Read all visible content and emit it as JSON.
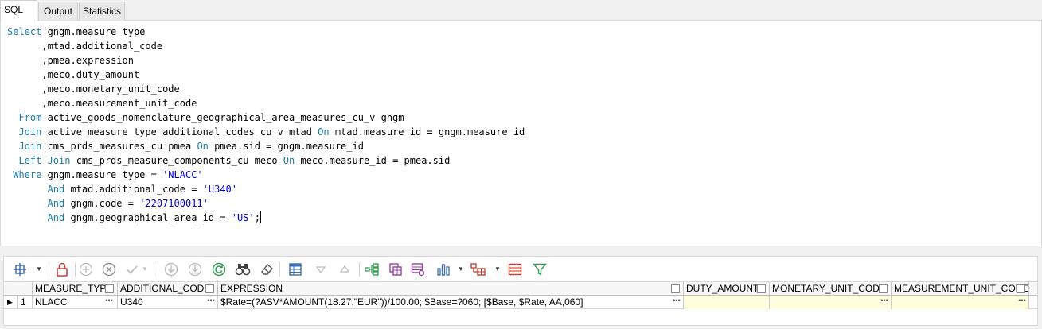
{
  "tabs": {
    "sql": "SQL",
    "output": "Output",
    "statistics": "Statistics"
  },
  "editor": {
    "lines": [
      [
        {
          "t": "Select",
          "k": "kw"
        },
        {
          "t": " gngm.measure_type"
        }
      ],
      [
        {
          "t": "      ,mtad.additional_code"
        }
      ],
      [
        {
          "t": "      ,pmea.expression"
        }
      ],
      [
        {
          "t": "      ,meco.duty_amount"
        }
      ],
      [
        {
          "t": "      ,meco.monetary_unit_code"
        }
      ],
      [
        {
          "t": "      ,meco.measurement_unit_code"
        }
      ],
      [
        {
          "t": "  "
        },
        {
          "t": "From",
          "k": "kw"
        },
        {
          "t": " active_goods_nomenclature_geographical_area_measures_cu_v gngm"
        }
      ],
      [
        {
          "t": "  "
        },
        {
          "t": "Join",
          "k": "kw"
        },
        {
          "t": " active_measure_type_additional_codes_cu_v mtad "
        },
        {
          "t": "On",
          "k": "kw"
        },
        {
          "t": " mtad.measure_id = gngm.measure_id"
        }
      ],
      [
        {
          "t": "  "
        },
        {
          "t": "Join",
          "k": "kw"
        },
        {
          "t": " cms_prds_measures_cu pmea "
        },
        {
          "t": "On",
          "k": "kw"
        },
        {
          "t": " pmea.sid = gngm.measure_id"
        }
      ],
      [
        {
          "t": "  "
        },
        {
          "t": "Left Join",
          "k": "kw"
        },
        {
          "t": " cms_prds_measure_components_cu meco "
        },
        {
          "t": "On",
          "k": "kw"
        },
        {
          "t": " meco.measure_id = pmea.sid"
        }
      ],
      [
        {
          "t": " "
        },
        {
          "t": "Where",
          "k": "kw"
        },
        {
          "t": " gngm.measure_type = "
        },
        {
          "t": "'NLACC'",
          "k": "str"
        }
      ],
      [
        {
          "t": "       "
        },
        {
          "t": "And",
          "k": "kw"
        },
        {
          "t": " mtad.additional_code = "
        },
        {
          "t": "'U340'",
          "k": "str"
        }
      ],
      [
        {
          "t": "       "
        },
        {
          "t": "And",
          "k": "kw"
        },
        {
          "t": " gngm.code = "
        },
        {
          "t": "'2207100011'",
          "k": "str"
        }
      ],
      [
        {
          "t": "       "
        },
        {
          "t": "And",
          "k": "kw"
        },
        {
          "t": " gngm.geographical_area_id = "
        },
        {
          "t": "'US'",
          "k": "str"
        },
        {
          "t": ";"
        }
      ]
    ]
  },
  "toolbar": {
    "icons": [
      "grid-options-icon",
      "lock-icon",
      "add-row-icon",
      "delete-row-icon",
      "post-edit-icon",
      "cancel-edit-icon",
      "fetch-next-icon",
      "fetch-last-icon",
      "refresh-icon",
      "find-icon",
      "clear-icon",
      "record-view-icon",
      "filter-down-icon",
      "filter-up-icon",
      "tree-view-icon",
      "export-icon",
      "table-settings-icon",
      "chart-icon",
      "pivot-icon",
      "grid-layout-icon",
      "funnel-icon"
    ]
  },
  "grid": {
    "columns": [
      "MEASURE_TYPE",
      "ADDITIONAL_CODE",
      "EXPRESSION",
      "DUTY_AMOUNT",
      "MONETARY_UNIT_CODE",
      "MEASUREMENT_UNIT_CODE"
    ],
    "rows": [
      {
        "indicator": "▶",
        "num": "1",
        "measure_type": "NLACC",
        "additional_code": "U340",
        "expression": "$Rate=(?ASV*AMOUNT(18.27,\"EUR\"))/100.00;  $Base=?060;  [$Base, $Rate, AA,060]",
        "duty_amount": "",
        "monetary_unit_code": "",
        "measurement_unit_code": ""
      }
    ],
    "ellipsis": "•••"
  }
}
